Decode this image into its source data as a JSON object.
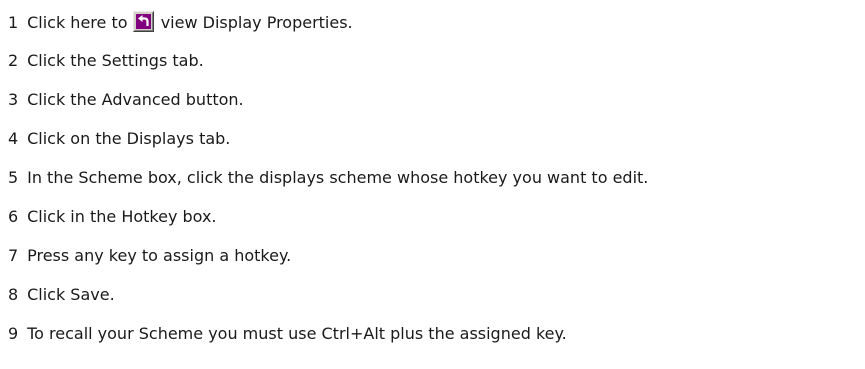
{
  "steps": [
    {
      "number": "1",
      "text_before": "Click here to",
      "text_after": "view Display Properties.",
      "icon": "shortcut-arrow-icon"
    },
    {
      "number": "2",
      "text": "Click the Settings tab."
    },
    {
      "number": "3",
      "text": "Click the Advanced button."
    },
    {
      "number": "4",
      "text": "Click on the Displays tab."
    },
    {
      "number": "5",
      "text": "In the Scheme box, click the displays scheme whose hotkey you want to edit."
    },
    {
      "number": "6",
      "text": "Click in the Hotkey box."
    },
    {
      "number": "7",
      "text": "Press any key to assign a hotkey."
    },
    {
      "number": "8",
      "text": "Click Save."
    },
    {
      "number": "9",
      "text": "To recall your Scheme you must use Ctrl+Alt plus the assigned key."
    }
  ],
  "colors": {
    "text": "#1a1a1a",
    "background": "#ffffff",
    "icon_bg": "#800080",
    "icon_arrow": "#ffffff"
  }
}
